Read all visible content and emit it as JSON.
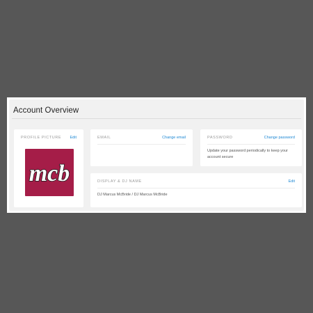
{
  "page": {
    "title": "Account Overview"
  },
  "profile": {
    "label": "PROFILE PICTURE",
    "action": "Edit",
    "logo_text": "mcb",
    "logo_color": "#a51d48"
  },
  "email": {
    "label": "EMAIL",
    "action": "Change email"
  },
  "password": {
    "label": "PASSWORD",
    "action": "Change password",
    "description_line1": "Update your password periodically to keep your",
    "description_line2": "account secure"
  },
  "display_name": {
    "label": "DISPLAY & DJ NAME",
    "action": "Edit",
    "value": "DJ Marcus McBride / DJ Marcus McBride"
  },
  "colors": {
    "accent": "#1e88d4",
    "background": "#575757",
    "panel": "#f1f1f1"
  }
}
